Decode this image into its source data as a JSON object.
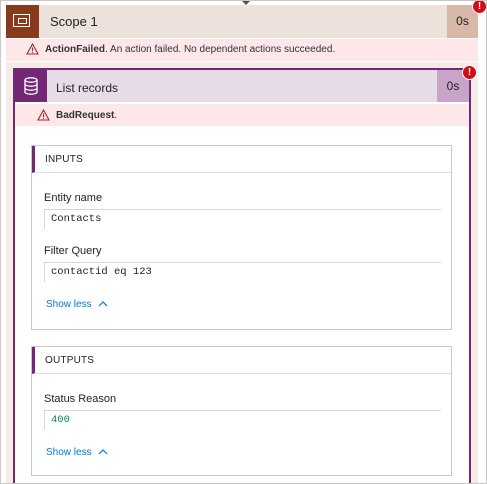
{
  "scope": {
    "title": "Scope 1",
    "duration": "0s",
    "error_code": "ActionFailed",
    "error_message": ". An action failed. No dependent actions succeeded.",
    "badge": "!"
  },
  "action": {
    "title": "List records",
    "duration": "0s",
    "error_code": "BadRequest",
    "error_suffix": ".",
    "badge": "!"
  },
  "inputs": {
    "heading": "INPUTS",
    "entity_label": "Entity name",
    "entity_value": "Contacts",
    "filter_label": "Filter Query",
    "filter_value": "contactid eq 123",
    "show_less": "Show less"
  },
  "outputs": {
    "heading": "OUTPUTS",
    "status_label": "Status Reason",
    "status_value": "400",
    "show_less": "Show less"
  },
  "colors": {
    "scope_accent": "#8a3a1c",
    "action_accent": "#742774",
    "error_bg": "#fde7e9",
    "link": "#0078d4",
    "badge": "#d10d19"
  },
  "icons": [
    "scope-icon",
    "warning-icon",
    "database-icon",
    "chevron-up-icon",
    "error-badge-icon"
  ]
}
